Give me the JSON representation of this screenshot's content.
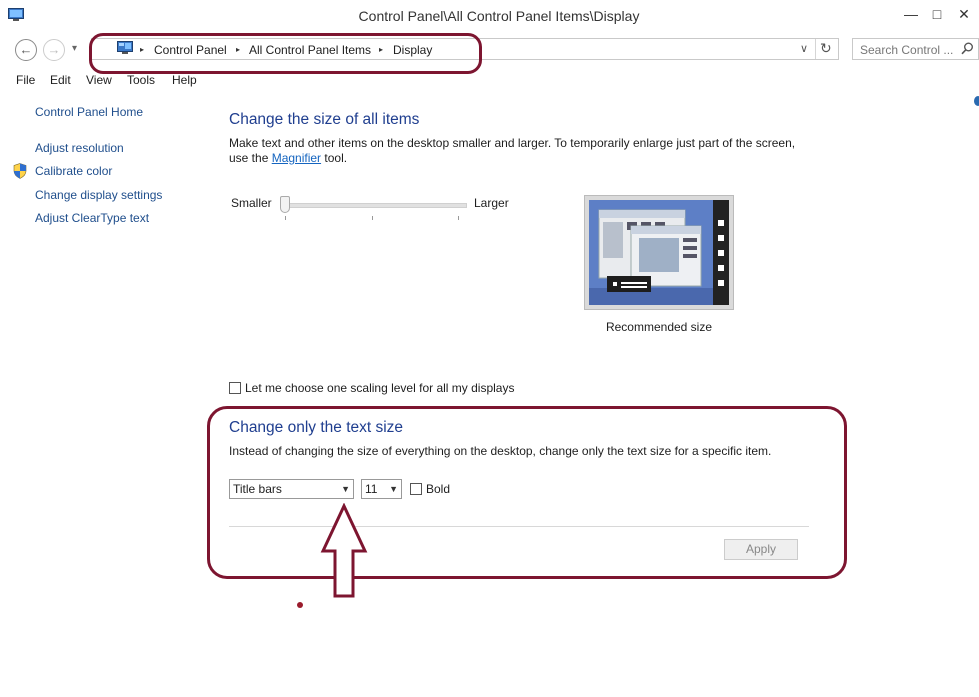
{
  "window": {
    "title": "Control Panel\\All Control Panel Items\\Display",
    "minimize_glyph": "—",
    "maximize_glyph": "□",
    "close_glyph": "✕"
  },
  "nav": {
    "back_glyph": "←",
    "forward_glyph": "→",
    "recent_glyph": "▾",
    "up_glyph": "↑",
    "dropdown_glyph": "∨",
    "refresh_glyph": "↻",
    "breadcrumbs": [
      "Control Panel",
      "All Control Panel Items",
      "Display"
    ],
    "crumb_separator": "▸",
    "search_placeholder": "Search Control ...",
    "search_icon": "search-icon"
  },
  "menu": [
    "File",
    "Edit",
    "View",
    "Tools",
    "Help"
  ],
  "sidebar": {
    "home": "Control Panel Home",
    "links": [
      "Adjust resolution",
      "Calibrate color",
      "Change display settings",
      "Adjust ClearType text"
    ]
  },
  "size_section": {
    "title": "Change the size of all items",
    "desc_line1": "Make text and other items on the desktop smaller and larger. To temporarily enlarge just part of the screen,",
    "desc_pre": "use the ",
    "desc_link": "Magnifier",
    "desc_post": " tool.",
    "smaller_label": "Smaller",
    "larger_label": "Larger",
    "slider_position": 0,
    "preview_caption": "Recommended size",
    "scaling_checkbox_label": "Let me choose one scaling level for all my displays",
    "scaling_checked": false
  },
  "text_section": {
    "title": "Change only the text size",
    "desc": "Instead of changing the size of everything on the desktop, change only the text size for a specific item.",
    "item_selected": "Title bars",
    "size_selected": "11",
    "bold_label": "Bold",
    "bold_checked": false,
    "apply_label": "Apply"
  },
  "colors": {
    "annotation": "#7d1530",
    "heading": "#1f3e8f",
    "link": "#1f4e8c"
  }
}
